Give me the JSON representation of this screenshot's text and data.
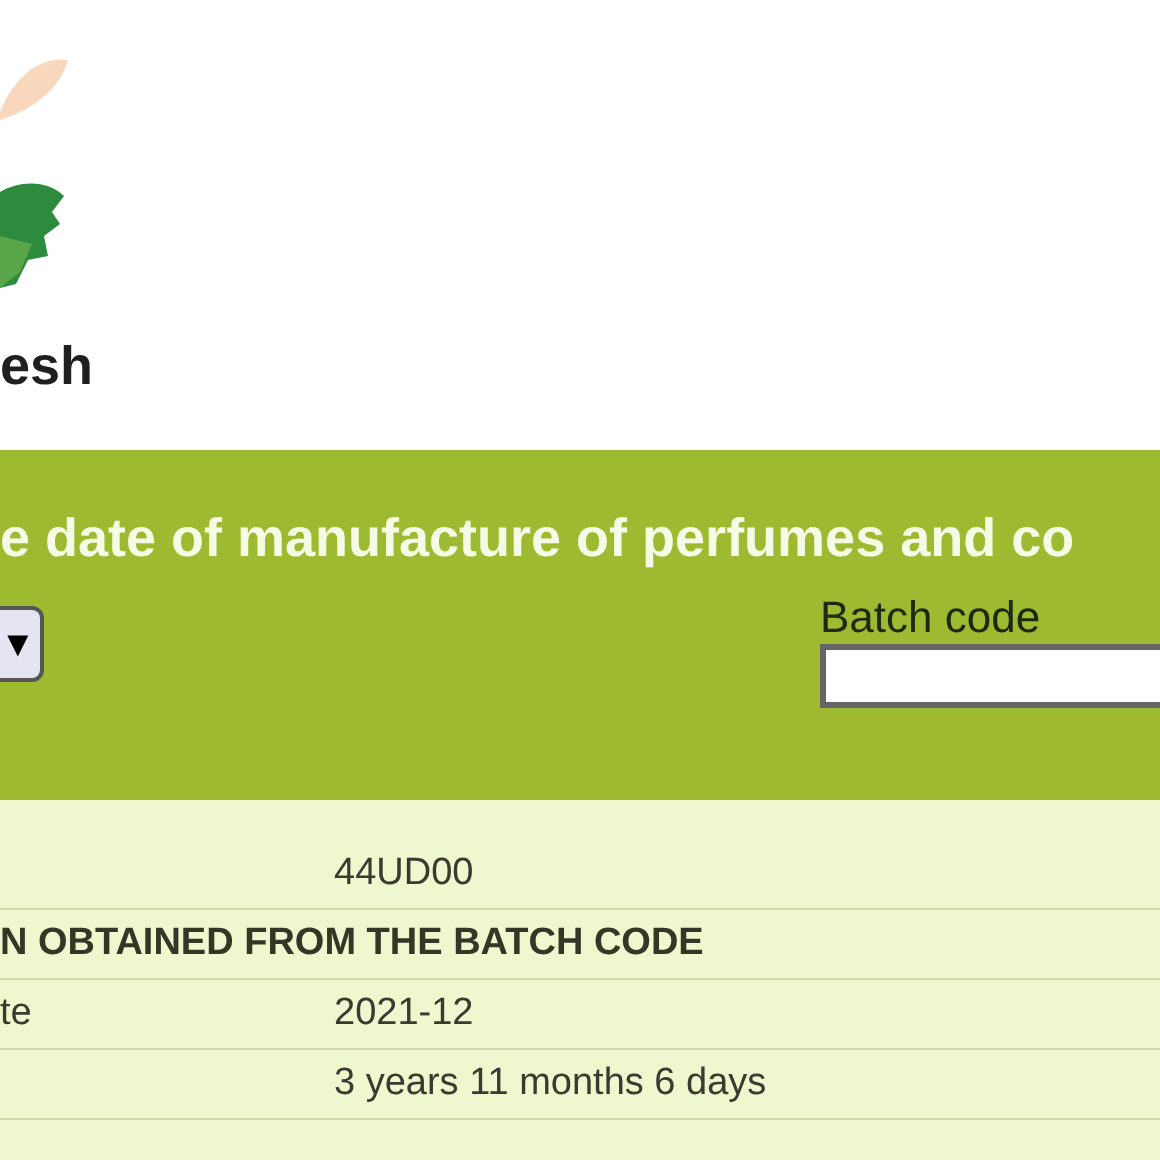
{
  "logo": {
    "text": "esh"
  },
  "banner": {
    "title": "e date of manufacture of perfumes and co",
    "dropdown": {
      "arrow": "▼"
    },
    "batch_field": {
      "label": "Batch code"
    }
  },
  "results": [
    {
      "kind": "row",
      "value": "44UD00"
    },
    {
      "kind": "heading",
      "label": "N OBTAINED FROM THE BATCH CODE"
    },
    {
      "kind": "row",
      "label": "te",
      "value": "2021-12"
    },
    {
      "kind": "row",
      "value": "3 years 11 months 6 days"
    }
  ]
}
